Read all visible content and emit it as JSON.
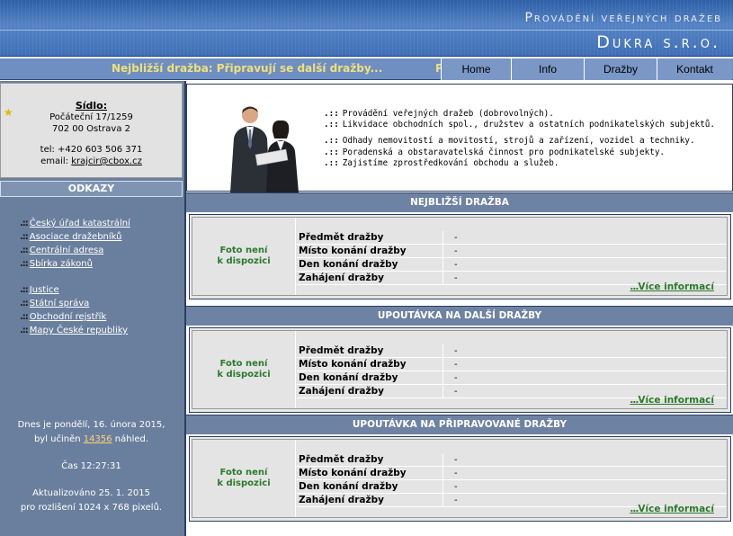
{
  "header": {
    "subtitle": "Provádění veřejných dražeb",
    "title": "Dukra s.r.o."
  },
  "ticker": {
    "text": "Nejbližší dražba: Připravují se další dražby...",
    "fragment": "P"
  },
  "menu": [
    {
      "label": "Home"
    },
    {
      "label": "Info"
    },
    {
      "label": "Dražby"
    },
    {
      "label": "Kontakt"
    }
  ],
  "sidebar": {
    "address": {
      "label": "Sídlo:",
      "street": "Počáteční 17/1259",
      "city": "702 00 Ostrava 2",
      "phone": "tel: +420 603 506 371",
      "email_label": "email:",
      "email": "krajcir@cbox.cz"
    },
    "links_title": "ODKAZY",
    "links_group1": [
      {
        "label": "Český úřad katastrální"
      },
      {
        "label": "Asociace dražebníků"
      },
      {
        "label": "Centrální adresa"
      },
      {
        "label": "Sbírka zákonů"
      }
    ],
    "links_group2": [
      {
        "label": "Justice"
      },
      {
        "label": "Státní správa"
      },
      {
        "label": "Obchodní rejstřík"
      },
      {
        "label": "Mapy České republiky"
      }
    ],
    "link_prefix": ".::",
    "date_line": "Dnes je pondělí, 16. února 2015,",
    "views_prefix": "byl učiněn",
    "views_count": "14356",
    "views_suffix": "náhled.",
    "time": "Čas 12:27:31",
    "updated": "Aktualizováno 25. 1. 2015",
    "resolution": "pro rozlišení 1024 x 768 pixelů."
  },
  "intro": {
    "prefix": ".::",
    "lines1": [
      "Provádění veřejných dražeb (dobrovolných).",
      "Likvidace obchodních spol., družstev a ostatních podnikatelských subjektů."
    ],
    "lines2": [
      "Odhady nemovitostí a movitostí, strojů a zařízení, vozidel a techniky.",
      "Poradenská a obstaravatelská činnost pro podnikatelské subjekty.",
      "Zajistíme zprostředkování obchodu a služeb."
    ]
  },
  "sections": [
    {
      "title": "NEJBLIŽŠÍ DRAŽBA",
      "photo_line1": "Foto není",
      "photo_line2": "k dispozici",
      "fields": [
        {
          "label": "Předmět dražby",
          "value": "-"
        },
        {
          "label": "Místo konání dražby",
          "value": "-"
        },
        {
          "label": "Den konání dražby",
          "value": "-"
        },
        {
          "label": "Zahájení dražby",
          "value": "-"
        }
      ],
      "more_prefix": "...",
      "more": "Více informací"
    },
    {
      "title": "UPOUTÁVKA NA DALŠÍ DRAŽBY",
      "photo_line1": "Foto není",
      "photo_line2": "k dispozici",
      "fields": [
        {
          "label": "Předmět dražby",
          "value": "-"
        },
        {
          "label": "Místo konání dražby",
          "value": "-"
        },
        {
          "label": "Den konání dražby",
          "value": "-"
        },
        {
          "label": "Zahájení dražby",
          "value": "-"
        }
      ],
      "more_prefix": "...",
      "more": "Více informací"
    },
    {
      "title": "UPOUTÁVKA NA PŘIPRAVOVANÉ DRAŽBY",
      "photo_line1": "Foto není",
      "photo_line2": "k dispozici",
      "fields": [
        {
          "label": "Předmět dražby",
          "value": "-"
        },
        {
          "label": "Místo konání dražby",
          "value": "-"
        },
        {
          "label": "Den konání dražby",
          "value": "-"
        },
        {
          "label": "Zahájení dražby",
          "value": "-"
        }
      ],
      "more_prefix": "...",
      "more": "Více informací"
    }
  ]
}
